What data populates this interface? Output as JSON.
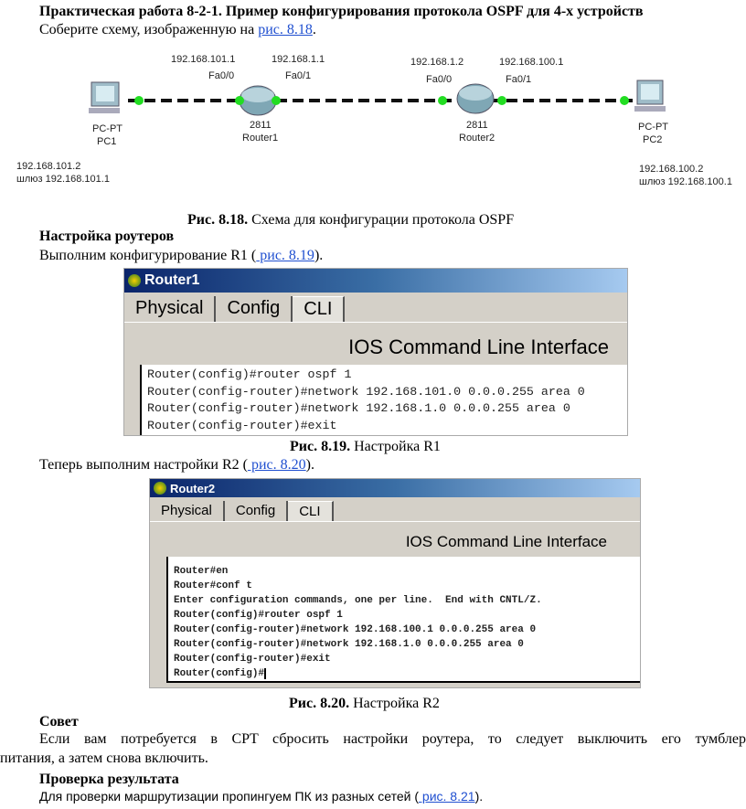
{
  "heading": "Практическая работа 8-2-1. Пример конфигурирования протокола OSPF для 4-х устройств",
  "intro": {
    "text": "Соберите схему, изображенную на ",
    "link": "рис. 8.18",
    "end": "."
  },
  "diagram": {
    "pc1": {
      "type": "PC-PT",
      "name": "PC1",
      "ip": "192.168.101.2",
      "gateway": "шлюз 192.168.101.1"
    },
    "router1": {
      "model": "2811",
      "name": "Router1",
      "fa00_ip": "192.168.101.1",
      "fa00": "Fa0/0",
      "fa01_ip": "192.168.1.1",
      "fa01": "Fa0/1"
    },
    "router2": {
      "model": "2811",
      "name": "Router2",
      "fa00_ip": "192.168.1.2",
      "fa00": "Fa0/0",
      "fa01_ip": "192.168.100.1",
      "fa01": "Fa0/1"
    },
    "pc2": {
      "type": "PC-PT",
      "name": "PC2",
      "ip": "192.168.100.2",
      "gateway": "шлюз 192.168.100.1"
    },
    "link_color": "#22dd22"
  },
  "fig818": {
    "num": "Рис. 8.18.",
    "text": " Схема для конфигурации протокола OSPF"
  },
  "section1": "Настройка роутеров",
  "r1_intro": {
    "text": "Выполним конфигурирование R1 (",
    "link": " рис. 8.19",
    "end": ")."
  },
  "router1_window": {
    "title": "Router1",
    "tabs": [
      "Physical",
      "Config",
      "CLI"
    ],
    "active_tab": "CLI",
    "header": "IOS Command Line Interface",
    "lines": [
      "Router(config)#router ospf 1",
      "Router(config-router)#network 192.168.101.0 0.0.0.255 area 0",
      "Router(config-router)#network 192.168.1.0 0.0.0.255 area 0",
      "Router(config-router)#exit"
    ]
  },
  "fig819": {
    "num": "Рис. 8.19.",
    "text": " Настройка R1"
  },
  "r2_intro": {
    "text": "Теперь выполним настройки R2 (",
    "link": " рис. 8.20",
    "end": ")."
  },
  "router2_window": {
    "title": "Router2",
    "tabs": [
      "Physical",
      "Config",
      "CLI"
    ],
    "active_tab": "CLI",
    "header": "IOS Command Line Interface",
    "lines": [
      "Router#en",
      "Router#conf t",
      "Enter configuration commands, one per line.  End with CNTL/Z.",
      "Router(config)#router ospf 1",
      "Router(config-router)#network 192.168.100.1 0.0.0.255 area 0",
      "Router(config-router)#network 192.168.1.0 0.0.0.255 area 0",
      "Router(config-router)#exit",
      "Router(config)#"
    ]
  },
  "fig820": {
    "num": "Рис. 8.20.",
    "text": " Настройка R2"
  },
  "tip_title": "Совет",
  "tip_line1": "Если вам потребуется в CPT сбросить настройки роутера, то следует выключить его тумблер",
  "tip_line2": "питания, а затем снова включить.",
  "section2": "Проверка результата",
  "check": {
    "text": "Для проверки маршрутизации пропингуем ПК из разных сетей (",
    "link": " рис. 8.21",
    "end": ")."
  }
}
